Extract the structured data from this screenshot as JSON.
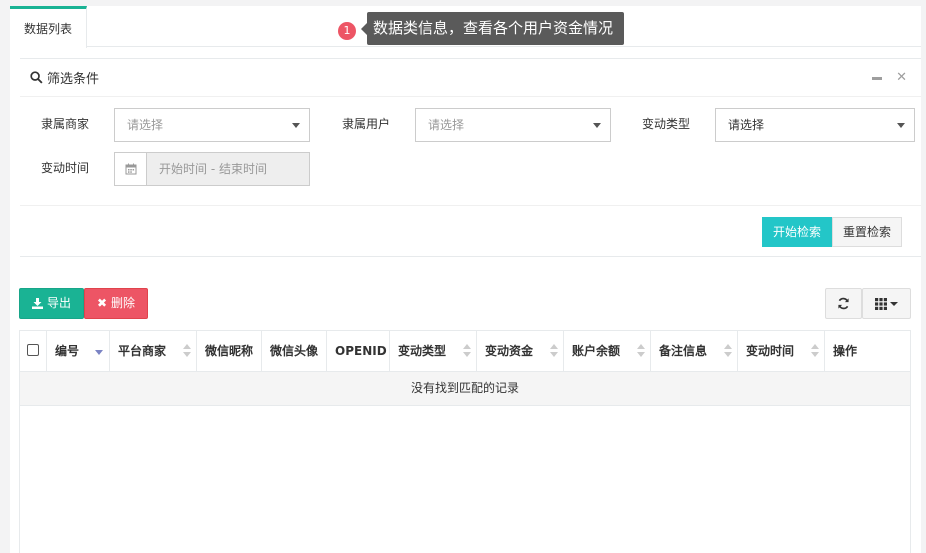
{
  "tabs": [
    {
      "label": "数据列表"
    }
  ],
  "tooltip": {
    "badge": "1",
    "text": "数据类信息，查看各个用户资金情况"
  },
  "filter": {
    "title": "筛选条件",
    "fields": {
      "merchant": {
        "label": "隶属商家",
        "value": "请选择"
      },
      "user": {
        "label": "隶属用户",
        "value": "请选择"
      },
      "change_type": {
        "label": "变动类型",
        "value": "请选择"
      },
      "change_time": {
        "label": "变动时间",
        "placeholder": "开始时间 - 结束时间"
      }
    },
    "search_label": "开始检索",
    "reset_label": "重置检索"
  },
  "toolbar": {
    "export_label": "导出",
    "delete_label": "删除"
  },
  "table": {
    "columns": [
      "编号",
      "平台商家",
      "微信昵称",
      "微信头像",
      "OPENID",
      "变动类型",
      "变动资金",
      "账户余额",
      "备注信息",
      "变动时间",
      "操作"
    ],
    "empty_text": "没有找到匹配的记录"
  },
  "colors": {
    "primary": "#1ab394",
    "danger": "#ed5565",
    "info": "#23c6c8",
    "badge": "#ed5565"
  }
}
